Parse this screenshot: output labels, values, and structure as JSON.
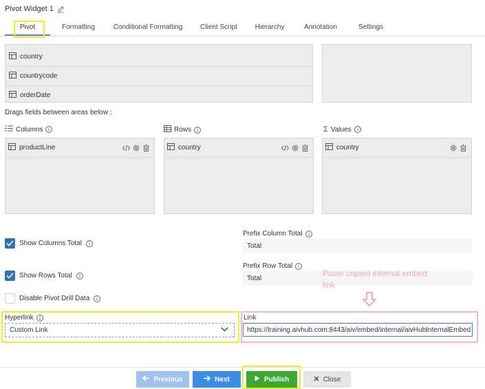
{
  "header": {
    "title": "Pivot Widget 1",
    "edit_icon": "pencil-edit-icon"
  },
  "tabs": [
    {
      "label": "Pivot",
      "active": true
    },
    {
      "label": "Formatting"
    },
    {
      "label": "Conditional Formatting"
    },
    {
      "label": "Client Script"
    },
    {
      "label": "Hierarchy"
    },
    {
      "label": "Annotation"
    },
    {
      "label": "Settings"
    }
  ],
  "fields": [
    "country",
    "countrycode",
    "orderDate"
  ],
  "drag_hint": "Drags fields between areas below :",
  "areas": {
    "columns": {
      "label": "Columns",
      "icon": "columns-icon",
      "items": [
        "productLine"
      ]
    },
    "rows": {
      "label": "Rows",
      "icon": "table-rows-icon",
      "items": [
        "country"
      ]
    },
    "values": {
      "label": "Values",
      "icon": "sigma-icon",
      "items": [
        "country"
      ]
    }
  },
  "options": {
    "show_columns_total": {
      "label": "Show Columns Total",
      "checked": true
    },
    "show_rows_total": {
      "label": "Show Rows Total",
      "checked": true
    },
    "disable_drill": {
      "label": "Disable Pivot Drill Data",
      "checked": false
    }
  },
  "prefix": {
    "column_total": {
      "label": "Prefix Column Total",
      "value": "Total"
    },
    "row_total": {
      "label": "Prefix Row Total",
      "value": "Total"
    }
  },
  "annotation_text": "Paste copied internal embed link",
  "hyperlink": {
    "label": "Hyperlink",
    "value": "Custom Link"
  },
  "link": {
    "label": "Link",
    "value": "https://training.aivhub.com:8443/aiv/embed/internal/aivHubInternalEmbed"
  },
  "buttons": {
    "previous": "Previous",
    "next": "Next",
    "publish": "Publish",
    "close": "Close"
  },
  "colors": {
    "accent": "#3a8ee8",
    "publish": "#3aa832",
    "highlight": "#f4ee1c",
    "annotation": "#f2a7c0"
  }
}
